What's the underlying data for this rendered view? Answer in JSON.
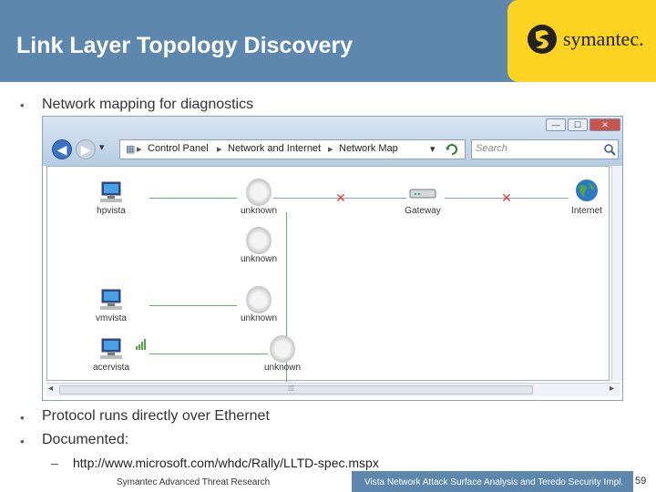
{
  "slide": {
    "title": "Link Layer Topology Discovery",
    "brand": "symantec.",
    "bullets": [
      "Network mapping for diagnostics",
      "Protocol runs directly over Ethernet",
      "Documented:"
    ],
    "bullet_symbol": "•",
    "sub_dash": "–",
    "sub_bullet": "http://www.microsoft.com/whdc/Rally/LLTD-spec.mspx"
  },
  "window": {
    "controls": {
      "minimize": "—",
      "maximize": "☐",
      "close": "✕"
    },
    "nav": {
      "back": "◀",
      "forward": "▶",
      "dropdown": "▾"
    },
    "breadcrumb": [
      "Control Panel",
      "Network and Internet",
      "Network Map"
    ],
    "separator": "▸",
    "search_placeholder": "Search",
    "network_map": {
      "nodes": [
        {
          "label": "hpvista"
        },
        {
          "label": "unknown"
        },
        {
          "label": "Gateway"
        },
        {
          "label": "Internet"
        },
        {
          "label": "unknown"
        },
        {
          "label": "vmvista"
        },
        {
          "label": "unknown"
        },
        {
          "label": "acervista"
        },
        {
          "label": "unknown"
        }
      ],
      "broken_link_mark": "✕"
    },
    "scroll": {
      "left_arrow": "◂",
      "right_arrow": "▸",
      "grip": "⁞⁞⁞"
    }
  },
  "footer": {
    "left": "Symantec Advanced Threat Research",
    "right": "Vista Network Attack Surface Analysis and Teredo Security Impl.",
    "page": "59"
  },
  "colors": {
    "header": "#5e87ad",
    "logo_bg": "#fcd321",
    "link_ok": "#5fb26b",
    "link_broken": "#d94040"
  },
  "icons": [
    "symantec-logo-icon",
    "back-icon",
    "forward-icon",
    "refresh-icon",
    "search-icon",
    "computer-icon",
    "router-icon",
    "globe-icon",
    "unknown-device-icon",
    "wireless-signal-icon"
  ]
}
